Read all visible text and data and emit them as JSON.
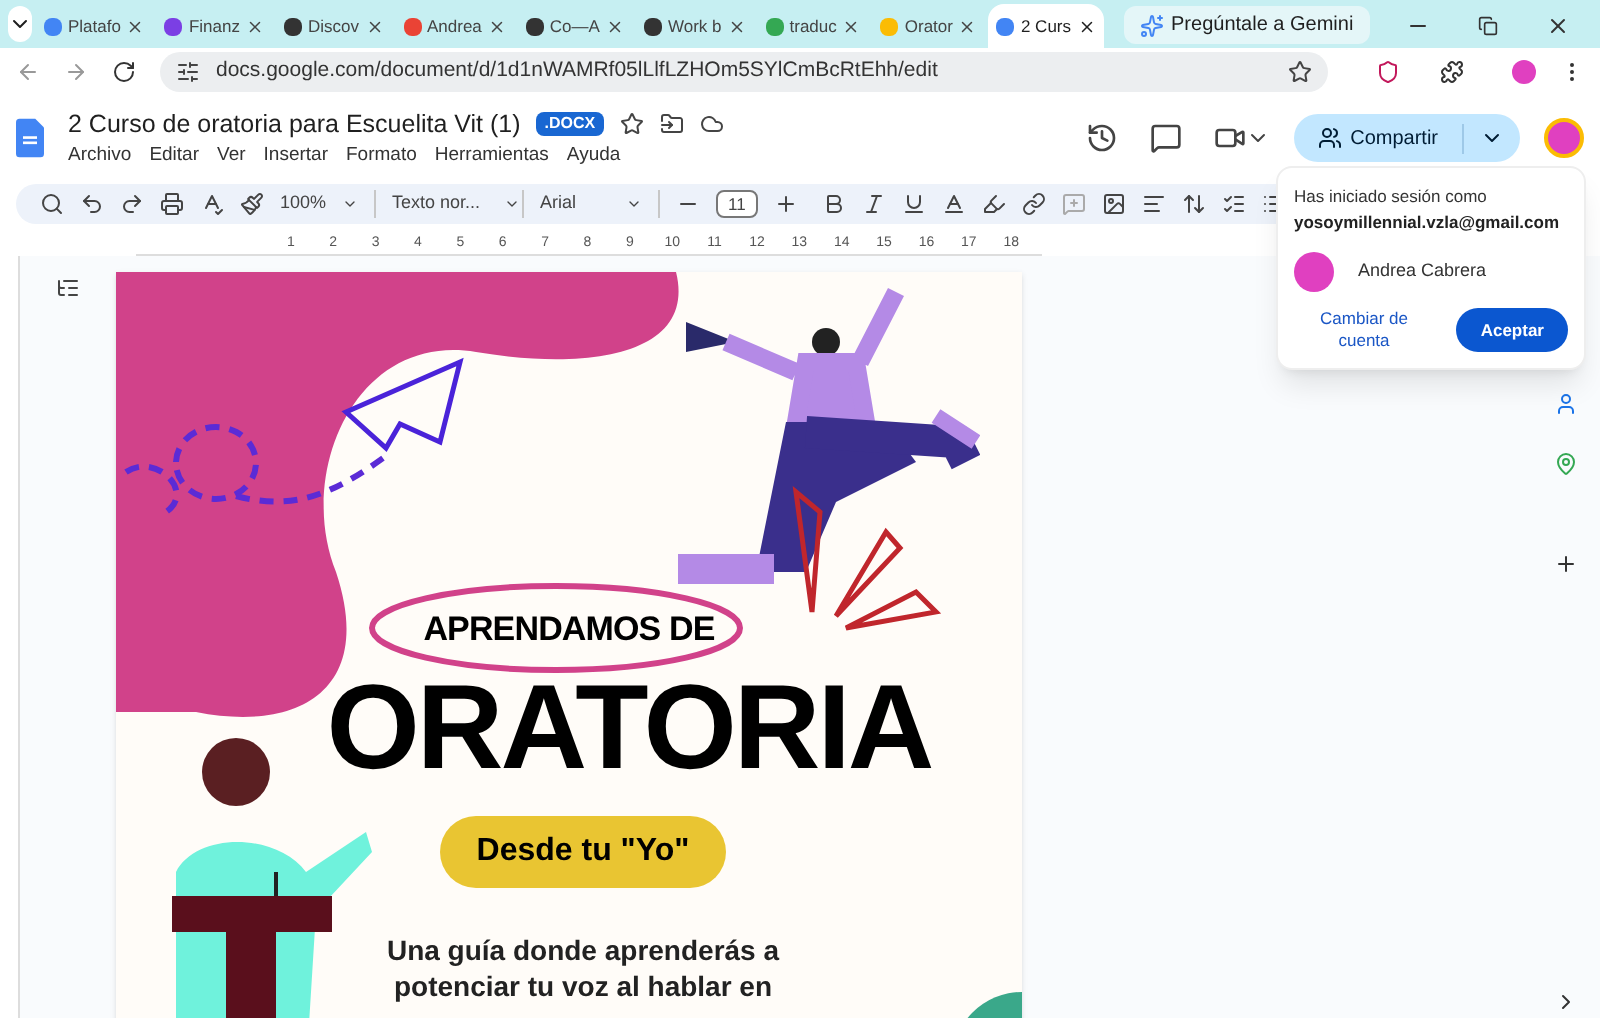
{
  "browser": {
    "tabs": [
      {
        "label": "Platafo",
        "selected": false
      },
      {
        "label": "Finanz",
        "selected": false
      },
      {
        "label": "Discov",
        "selected": false
      },
      {
        "label": "Andrea",
        "selected": false
      },
      {
        "label": "Co—A",
        "selected": false
      },
      {
        "label": "Work b",
        "selected": false
      },
      {
        "label": "traduc",
        "selected": false
      },
      {
        "label": "Orator",
        "selected": false
      },
      {
        "label": "2 Curs",
        "selected": true
      }
    ],
    "gemini_button": "Pregúntale a Gemini",
    "address": "docs.google.com/document/d/1d1nWAMRf05lLlfLZHOm5SYlCmBcRtEhh/edit"
  },
  "document": {
    "title": "2 Curso de oratoria para Escuelita Vit (1)",
    "badge": ".DOCX",
    "menu": [
      "Archivo",
      "Editar",
      "Ver",
      "Insertar",
      "Formato",
      "Herramientas",
      "Ayuda"
    ],
    "share_button": "Compartir"
  },
  "toolbar": {
    "zoom": "100%",
    "style": "Texto nor...",
    "font": "Arial",
    "font_size": "11"
  },
  "ruler": {
    "labels": [
      "1",
      "2",
      "3",
      "4",
      "5",
      "6",
      "7",
      "8",
      "9",
      "10",
      "11",
      "12",
      "13",
      "14",
      "15",
      "16",
      "17",
      "18"
    ]
  },
  "poster": {
    "kicker": "APRENDAMOS DE",
    "heading": "ORATORIA",
    "pill": "Desde tu \"Yo\"",
    "subtitle_lines": [
      "Una guía donde aprenderás a",
      "potenciar tu voz al hablar en"
    ]
  },
  "account_popup": {
    "signed_in_label": "Has iniciado sesión como",
    "email": "yosoymillennial.vzla@gmail.com",
    "name": "Andrea Cabrera",
    "switch_link": "Cambiar de cuenta",
    "accept_button": "Aceptar"
  }
}
